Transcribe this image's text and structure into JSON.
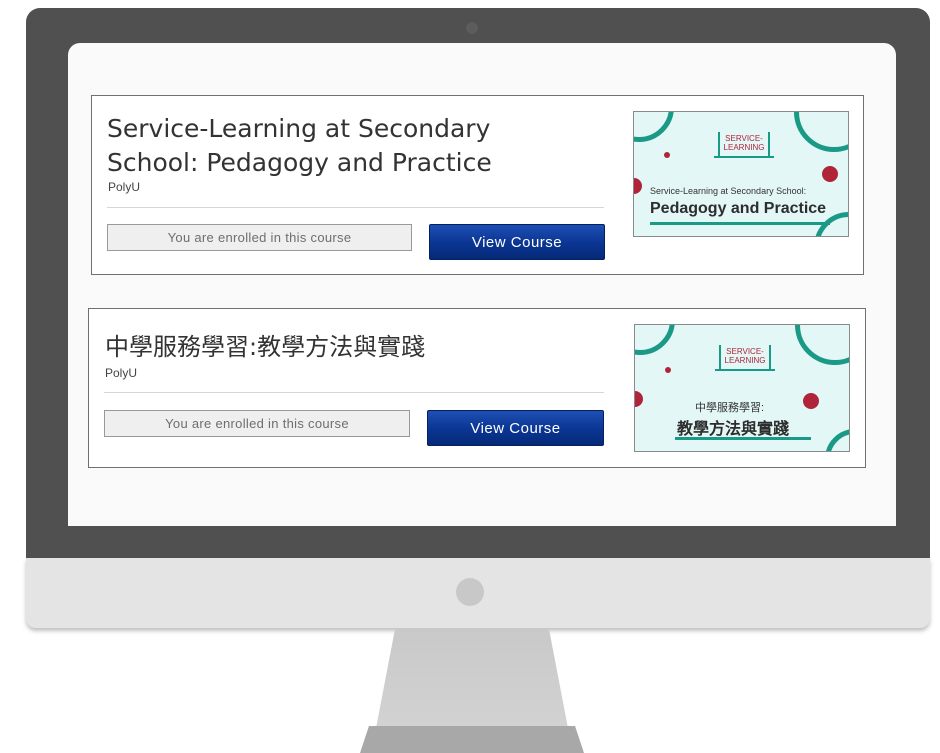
{
  "courses": [
    {
      "title": "Service-Learning at Secondary School: Pedagogy and Practice",
      "org": "PolyU",
      "enrolled_label": "You are enrolled in this course",
      "button_label": "View Course",
      "thumbnail": {
        "badge_line1": "SERVICE-",
        "badge_line2": "LEARNING",
        "subtitle": "Service-Learning at Secondary School:",
        "title": "Pedagogy and Practice"
      }
    },
    {
      "title": "中學服務學習:教學方法與實踐",
      "org": "PolyU",
      "enrolled_label": "You are enrolled in this course",
      "button_label": "View Course",
      "thumbnail": {
        "badge_line1": "SERVICE-",
        "badge_line2": "LEARNING",
        "subtitle": "中學服務學習:",
        "title": "教學方法與實踐"
      }
    }
  ],
  "colors": {
    "accent_teal": "#1a9a86",
    "accent_red": "#b0243a",
    "button_blue": "#0a3592",
    "bezel": "#505050"
  }
}
